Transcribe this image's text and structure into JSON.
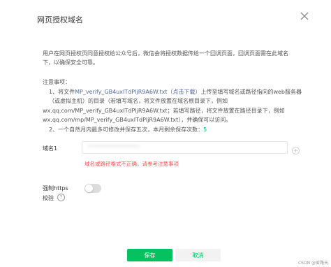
{
  "dialog": {
    "title": "网页授权域名"
  },
  "intro": {
    "line1": "用户在网页授权页同意授权给公众号后，微信会将授权数据传给一个回调页面，回调页面需在此域名",
    "line2": "下，以确保安全可靠。"
  },
  "notes": {
    "heading": "注意事项：",
    "item1_prefix": "1、将文件",
    "item1_file": "MP_verify_GB4uxITdPIjR9A6W.txt",
    "item1_download": "（点击下载）",
    "item1_suffix": "上传至填写域名或路径指向的web服务器",
    "line2": "（或虚拟主机）的目录（若填写域名，将文件放置在域名根目录下，例如",
    "line3": "wx.qq.com/MP_verify_GB4uxITdPIjR9A6W.txt；若填写路径，将文件放置在路径目录下，例如",
    "line4": "wx.qq.com/mp/MP_verify_GB4uxITdPIjR9A6W.txt），并确保可以访问。",
    "item2_prefix": "2、一个自然月内最多可修改并保存五次，本月剩余保存次数：",
    "item2_count": "5"
  },
  "form": {
    "domain_label": "域名1",
    "domain_value": "***************",
    "error_text": "域名或路径格式不正确，请参考注意事项",
    "https_label_line1": "强制https",
    "https_label_line2": "校验",
    "https_enabled": false,
    "help_symbol": "?"
  },
  "footer": {
    "save_label": "保存",
    "cancel_label": "取消"
  },
  "watermark": "CSDN @爱路天",
  "colors": {
    "primary": "#07c160",
    "link": "#576b95",
    "error": "#fa5151"
  }
}
